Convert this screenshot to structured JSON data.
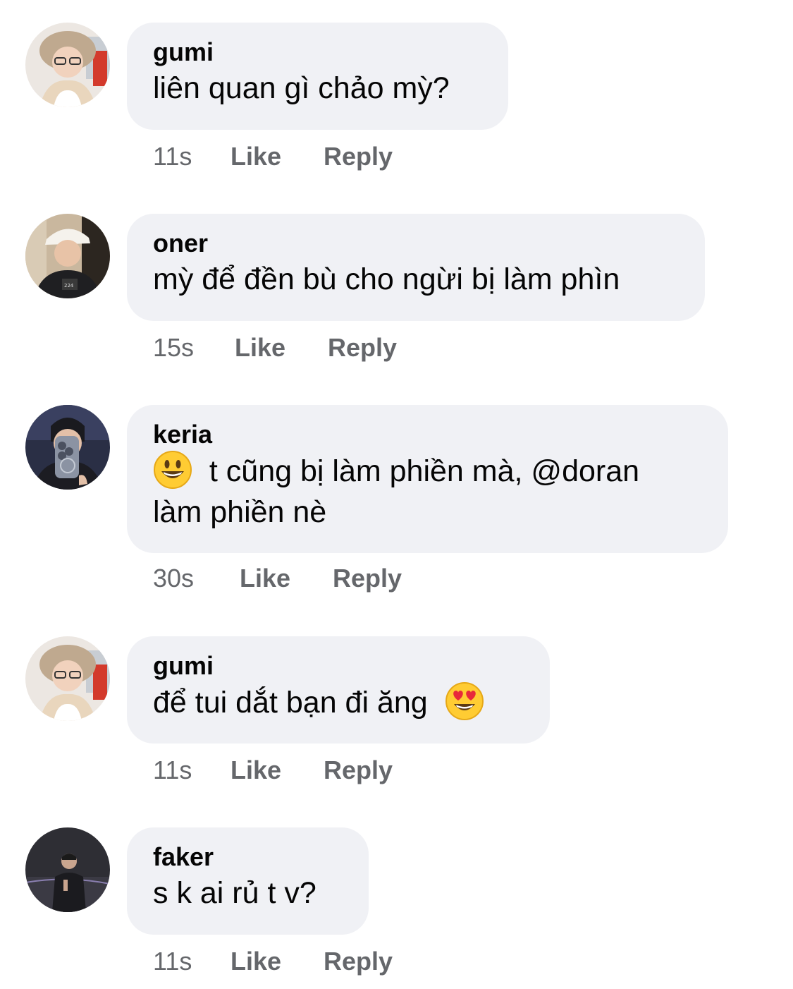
{
  "comments": [
    {
      "author": "gumi",
      "text": "liên quan gì chảo mỳ?",
      "time": "11s",
      "like": "Like",
      "reply": "Reply",
      "avatar_icon": "gumi-avatar-icon"
    },
    {
      "author": "oner",
      "text": "mỳ để đền bù cho ngừi bị làm phìn",
      "time": "15s",
      "like": "Like",
      "reply": "Reply",
      "avatar_icon": "oner-avatar-icon"
    },
    {
      "author": "keria",
      "text_line1": "t cũng bị làm phiền mà, @doran",
      "text_line2": "làm phiền nè",
      "emoji": "grinning-face-emoji",
      "time": "30s",
      "like": "Like",
      "reply": "Reply",
      "avatar_icon": "keria-avatar-icon"
    },
    {
      "author": "gumi",
      "text": "để tui dắt bạn đi ăng",
      "emoji": "heart-eyes-emoji",
      "time": "11s",
      "like": "Like",
      "reply": "Reply",
      "avatar_icon": "gumi-avatar-icon"
    },
    {
      "author": "faker",
      "text": "s k ai rủ t v?",
      "time": "11s",
      "like": "Like",
      "reply": "Reply",
      "avatar_icon": "faker-avatar-icon"
    }
  ],
  "colors": {
    "bubble": "#f0f1f5",
    "text": "#050505",
    "meta": "#65676b"
  }
}
